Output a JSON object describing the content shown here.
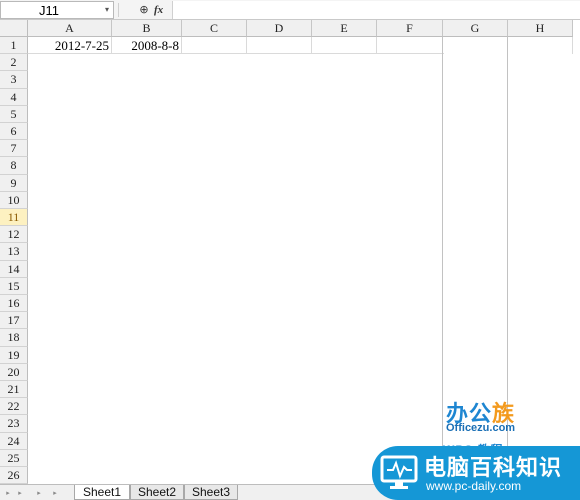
{
  "formula_bar": {
    "name_box": "J11",
    "dropdown_glyph": "▾",
    "zoom_glyph": "⊕",
    "fx_label": "fx",
    "formula_value": ""
  },
  "columns": [
    "A",
    "B",
    "C",
    "D",
    "E",
    "F",
    "G",
    "H"
  ],
  "rows": [
    "1",
    "2",
    "3",
    "4",
    "5",
    "6",
    "7",
    "8",
    "9",
    "10",
    "11",
    "12",
    "13",
    "14",
    "15",
    "16",
    "17",
    "18",
    "19",
    "20",
    "21",
    "22",
    "23",
    "24",
    "25",
    "26"
  ],
  "active_row": "11",
  "cells": {
    "A1": "2012-7-25",
    "B1": "2008-8-8"
  },
  "sheets": {
    "tabs": [
      "Sheet1",
      "Sheet2",
      "Sheet3"
    ],
    "active": "Sheet1",
    "nav_glyph": "▸"
  },
  "watermark": {
    "brand_a": "办公",
    "brand_b": "族",
    "brand_url": "Officezu.com",
    "wps_label": "WPS 教程",
    "site_title": "电脑百科知识",
    "site_url": "www.pc-daily.com"
  },
  "colors": {
    "active_row_bg": "#fdf1c1",
    "watermark_blue": "#1597d6",
    "watermark_orange": "#f39a1e"
  }
}
